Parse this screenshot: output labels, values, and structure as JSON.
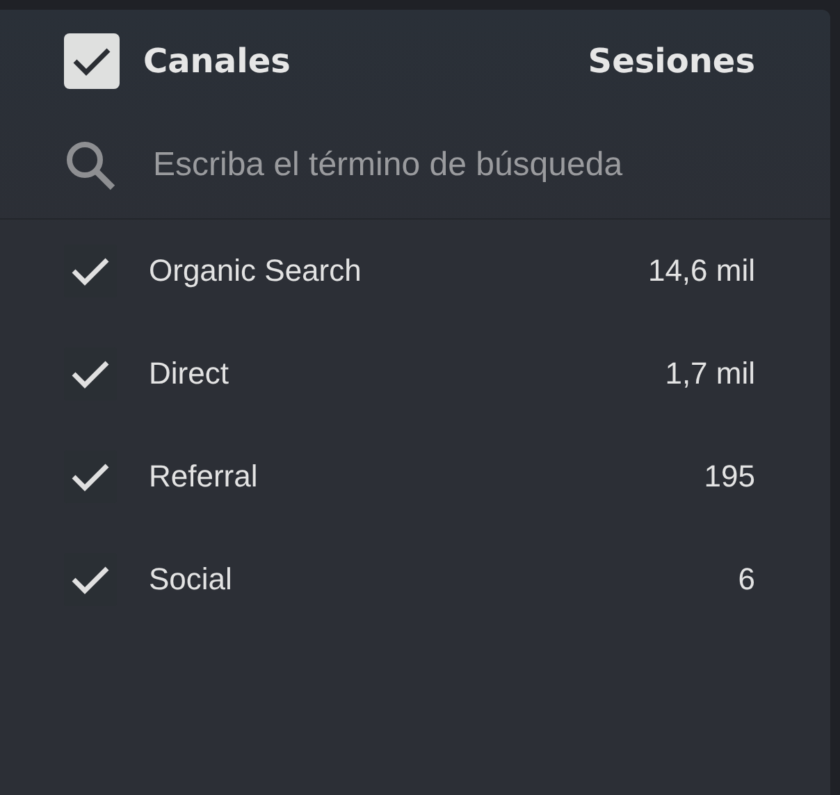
{
  "header": {
    "label": "Canales",
    "checked": true,
    "column": "Sesiones"
  },
  "search": {
    "placeholder": "Escriba el término de búsqueda"
  },
  "rows": [
    {
      "name": "Organic Search",
      "value": "14,6 mil",
      "checked": true
    },
    {
      "name": "Direct",
      "value": "1,7 mil",
      "checked": true
    },
    {
      "name": "Referral",
      "value": "195",
      "checked": true
    },
    {
      "name": "Social",
      "value": "6",
      "checked": true
    }
  ]
}
